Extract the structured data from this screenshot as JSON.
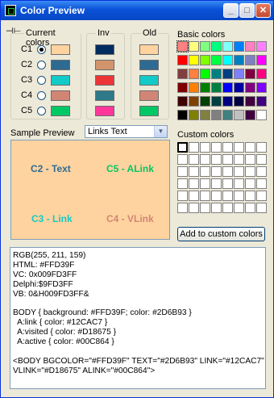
{
  "window": {
    "title": "Color Preview",
    "minimize_glyph": "_",
    "maximize_glyph": "□",
    "close_glyph": "✕"
  },
  "pin_icon": "pin-icon",
  "groups": {
    "current": "Current colors",
    "inv": "Inv",
    "old": "Old",
    "basic": "Basic colors"
  },
  "rows": [
    {
      "label": "C1",
      "checked": true,
      "current": "#FFD39F",
      "inv": "#002C60",
      "old": "#FFD39F"
    },
    {
      "label": "C2",
      "checked": false,
      "current": "#2D6B93",
      "inv": "#D2946C",
      "old": "#2D6B93"
    },
    {
      "label": "C3",
      "checked": false,
      "current": "#12CAC7",
      "inv": "#ED3538",
      "old": "#12CAC7"
    },
    {
      "label": "C4",
      "checked": false,
      "current": "#D18675",
      "inv": "#2E798A",
      "old": "#D18675"
    },
    {
      "label": "C5",
      "checked": false,
      "current": "#00C864",
      "inv": "#FF379B",
      "old": "#00C864"
    }
  ],
  "basic_colors": [
    "#ff8080",
    "#ffff80",
    "#80ff80",
    "#00ff80",
    "#80ffff",
    "#0080ff",
    "#ff80c0",
    "#ff80ff",
    "#ff0000",
    "#ffff00",
    "#80ff00",
    "#00ff40",
    "#00ffff",
    "#0080c0",
    "#8080c0",
    "#ff00ff",
    "#804040",
    "#ff8040",
    "#00ff00",
    "#008080",
    "#004080",
    "#8080ff",
    "#800040",
    "#ff0080",
    "#800000",
    "#ff8000",
    "#008000",
    "#008040",
    "#0000ff",
    "#0000a0",
    "#800080",
    "#8000ff",
    "#400000",
    "#804000",
    "#004000",
    "#004040",
    "#000080",
    "#000040",
    "#400040",
    "#400080",
    "#000000",
    "#808000",
    "#808040",
    "#808080",
    "#408080",
    "#c0c0c0",
    "#400040",
    "#ffffff"
  ],
  "sample_preview_label": "Sample Preview",
  "dropdown": {
    "value": "Links Text",
    "arrow": "▼"
  },
  "custom_colors_label": "Custom colors",
  "custom_color_count": 48,
  "preview": {
    "background": "#FFD39F",
    "c2": {
      "text": "C2 - Text",
      "color": "#2D6B93"
    },
    "c5": {
      "text": "C5 - ALink",
      "color": "#00C864"
    },
    "c3": {
      "text": "C3 - Link",
      "color": "#12CAC7"
    },
    "c4": {
      "text": "C4 - VLink",
      "color": "#D18675"
    }
  },
  "add_button": "Add to custom colors",
  "output_lines": [
    "RGB(255, 211, 159)",
    "HTML: #FFD39F",
    "VC: 0x009FD3FF",
    "Delphi:$9FD3FF",
    "VB: 0&H009FD3FF&",
    "",
    "BODY { background: #FFD39F; color: #2D6B93 }",
    "  A:link { color: #12CAC7 }",
    "  A:visited { color: #D18675 }",
    "  A:active { color: #00C864 }",
    "",
    "<BODY BGCOLOR=\"#FFD39F\" TEXT=\"#2D6B93\" LINK=\"#12CAC7\"",
    "VLINK=\"#D18675\" ALINK=\"#00C864\">"
  ]
}
